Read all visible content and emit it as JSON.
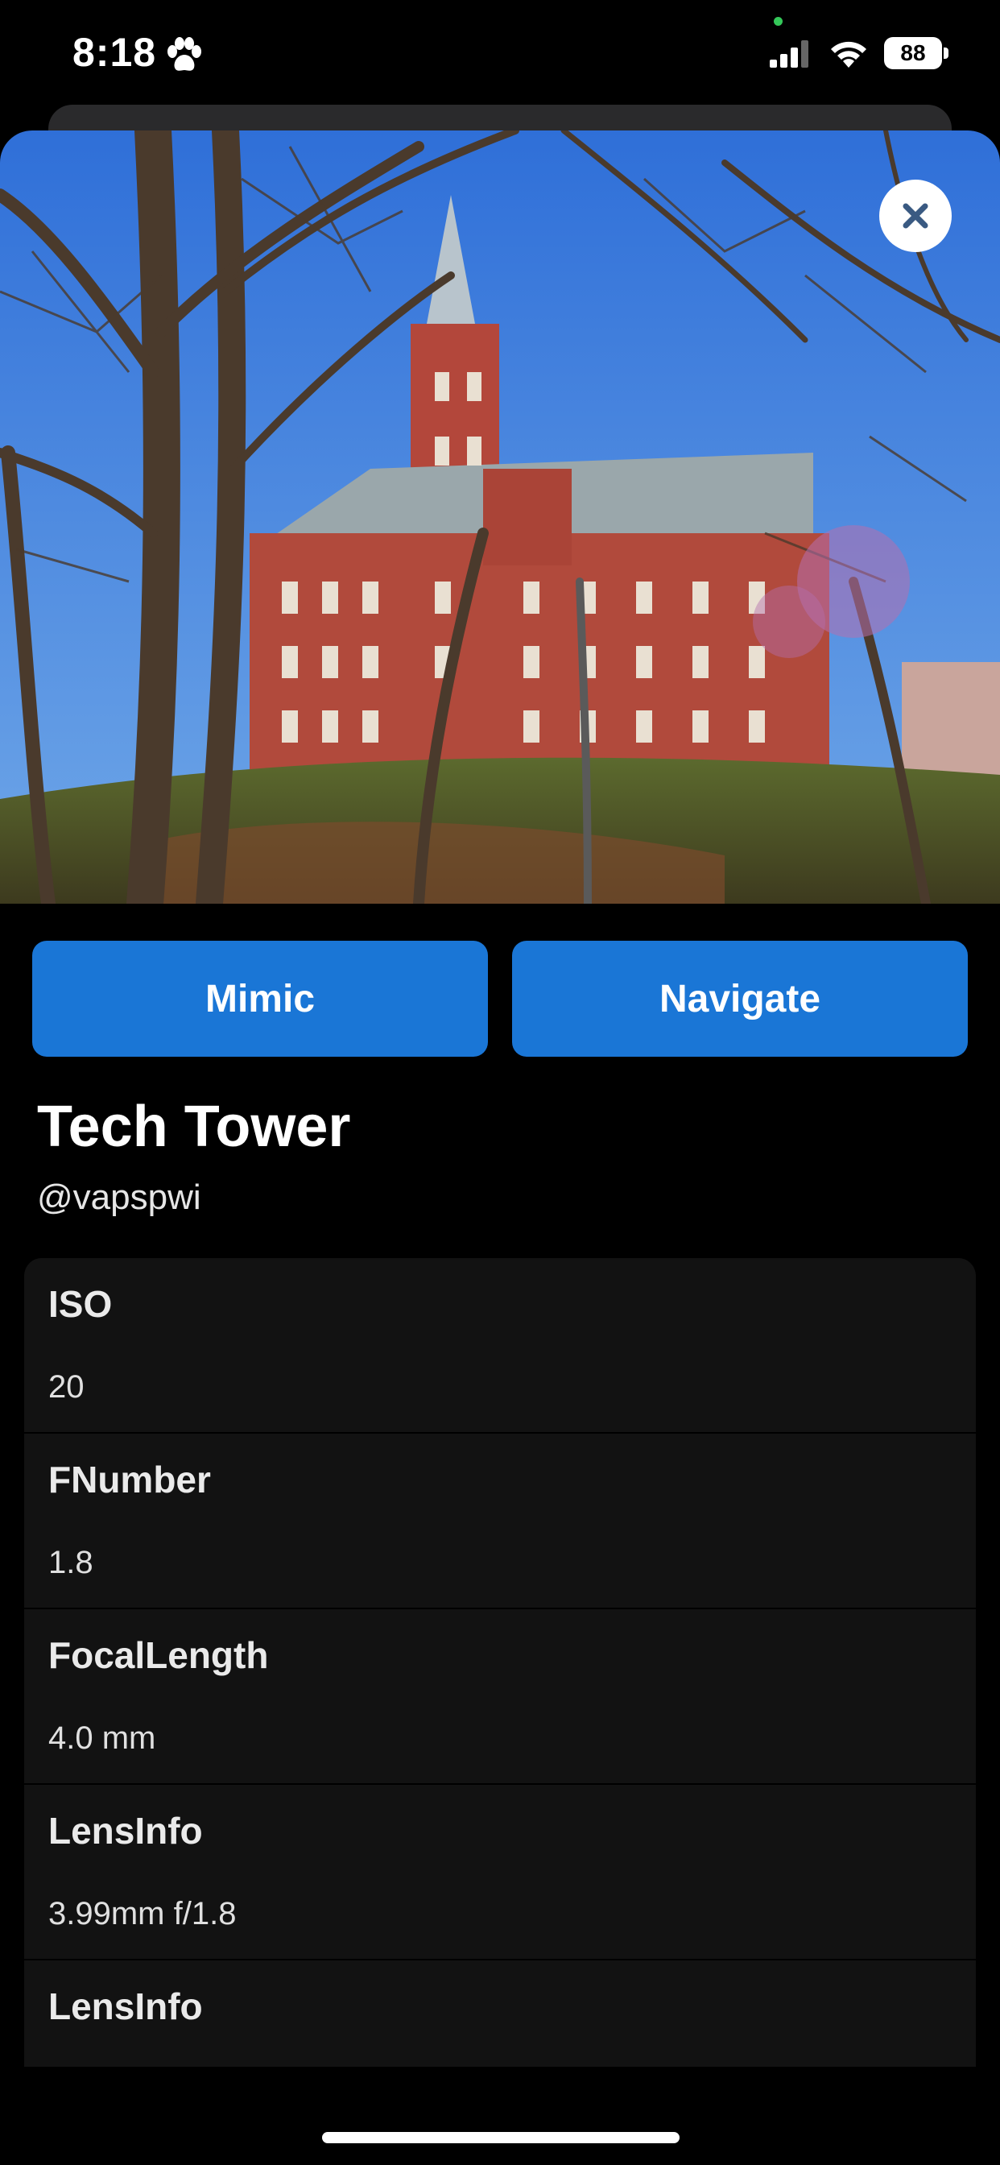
{
  "status_bar": {
    "time": "8:18",
    "battery": "88",
    "icons": [
      "paw-icon",
      "signal-icon",
      "wifi-icon",
      "battery-icon"
    ]
  },
  "photo": {
    "alt": "Tech Tower"
  },
  "actions": {
    "mimic_label": "Mimic",
    "navigate_label": "Navigate"
  },
  "place": {
    "title": "Tech Tower",
    "username": "@vapspwi"
  },
  "exif": [
    {
      "label": "ISO",
      "value": "20"
    },
    {
      "label": "FNumber",
      "value": "1.8"
    },
    {
      "label": "FocalLength",
      "value": "4.0 mm"
    },
    {
      "label": "LensInfo",
      "value": "3.99mm f/1.8"
    },
    {
      "label": "LensInfo",
      "value": ""
    }
  ],
  "colors": {
    "accent": "#1a76d6",
    "background": "#000000",
    "card": "#121212"
  }
}
